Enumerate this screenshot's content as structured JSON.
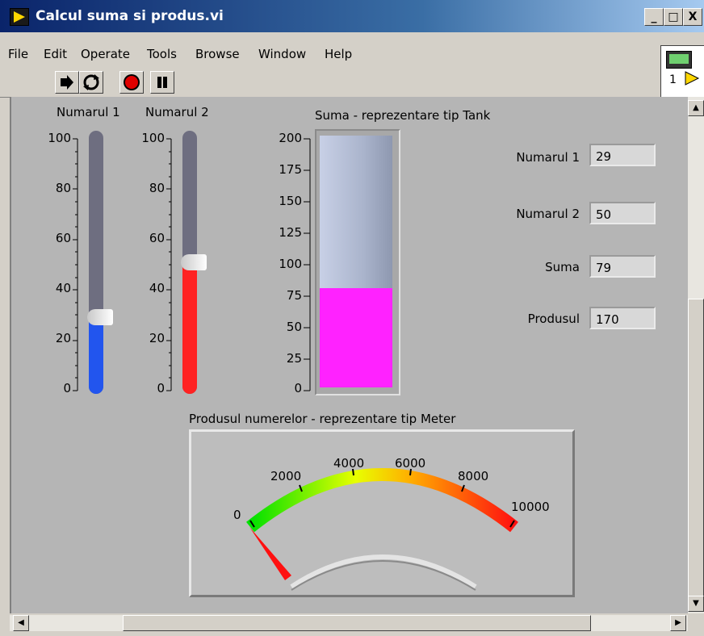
{
  "window": {
    "title": "Calcul suma si produs.vi",
    "controls": [
      "_",
      "□",
      "X"
    ]
  },
  "menu": [
    "File",
    "Edit",
    "Operate",
    "Tools",
    "Browse",
    "Window",
    "Help"
  ],
  "toolbar": {
    "run_icon": "run-arrow-icon",
    "continuous_icon": "run-continuously-icon",
    "stop_icon": "abort-icon",
    "pause_icon": "pause-icon"
  },
  "connector_pane": {
    "label": "1"
  },
  "slider1": {
    "label": "Numarul 1",
    "value": 29,
    "min": 0,
    "max": 100,
    "ticks": [
      "100",
      "80",
      "60",
      "40",
      "20",
      "0"
    ],
    "fill_color": "#2255ee"
  },
  "slider2": {
    "label": "Numarul 2",
    "value": 50,
    "min": 0,
    "max": 100,
    "ticks": [
      "100",
      "80",
      "60",
      "40",
      "20",
      "0"
    ],
    "fill_color": "#ff2222"
  },
  "tank": {
    "label": "Suma - reprezentare tip Tank",
    "value": 79,
    "min": 0,
    "max": 200,
    "ticks": [
      "200",
      "175",
      "150",
      "125",
      "100",
      "75",
      "50",
      "25",
      "0"
    ],
    "fill_color": "#ff22ff"
  },
  "indicators": [
    {
      "label": "Numarul 1",
      "value": "29"
    },
    {
      "label": "Numarul 2",
      "value": "50"
    },
    {
      "label": "Suma",
      "value": "79"
    },
    {
      "label": "Produsul",
      "value": "170"
    }
  ],
  "meter": {
    "label": "Produsul numerelor - reprezentare tip Meter",
    "value": 170,
    "min": 0,
    "max": 10000,
    "ticks": [
      "0",
      "2000",
      "4000",
      "6000",
      "8000",
      "10000"
    ]
  }
}
